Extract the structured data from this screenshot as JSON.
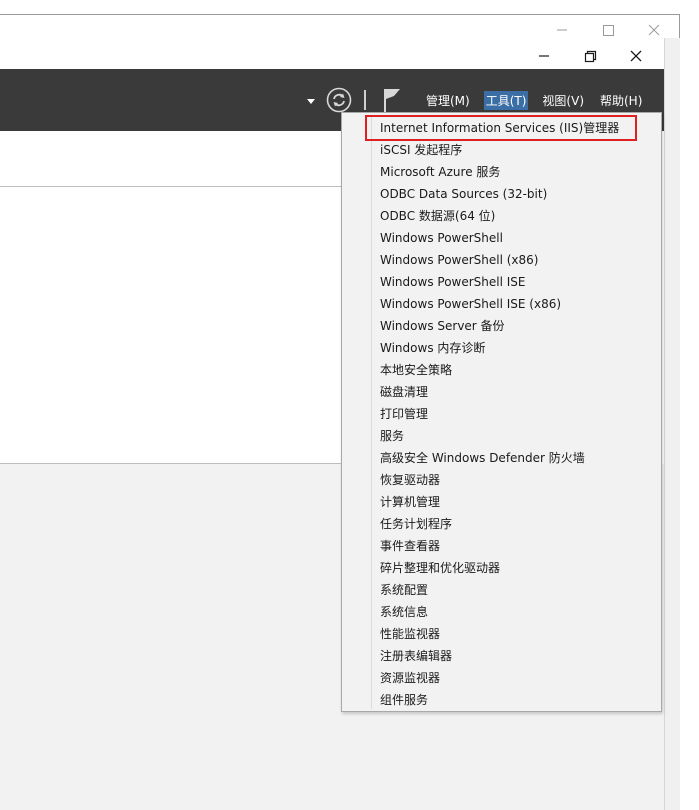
{
  "window": {
    "outer_controls": [
      "minimize",
      "maximize",
      "close"
    ],
    "inner_controls": [
      "minimize",
      "restore",
      "close"
    ]
  },
  "header": {
    "menus": [
      {
        "label": "管理(M)",
        "active": false
      },
      {
        "label": "工具(T)",
        "active": true
      },
      {
        "label": "视图(V)",
        "active": false
      },
      {
        "label": "帮助(H)",
        "active": false
      }
    ]
  },
  "tools_menu": {
    "items": [
      "Internet Information Services (IIS)管理器",
      "iSCSI 发起程序",
      "Microsoft Azure 服务",
      "ODBC Data Sources (32-bit)",
      "ODBC 数据源(64 位)",
      "Windows PowerShell",
      "Windows PowerShell (x86)",
      "Windows PowerShell ISE",
      "Windows PowerShell ISE (x86)",
      "Windows Server 备份",
      "Windows 内存诊断",
      "本地安全策略",
      "磁盘清理",
      "打印管理",
      "服务",
      "高级安全 Windows Defender 防火墙",
      "恢复驱动器",
      "计算机管理",
      "任务计划程序",
      "事件查看器",
      "碎片整理和优化驱动器",
      "系统配置",
      "系统信息",
      "性能监视器",
      "注册表编辑器",
      "资源监视器",
      "组件服务"
    ],
    "highlighted_index": 0,
    "highlight_color": "#e02020"
  },
  "colors": {
    "header_bg": "#3a3a3a",
    "active_menu_bg": "#3b6ea5",
    "menu_bg": "#f2f2f2"
  }
}
